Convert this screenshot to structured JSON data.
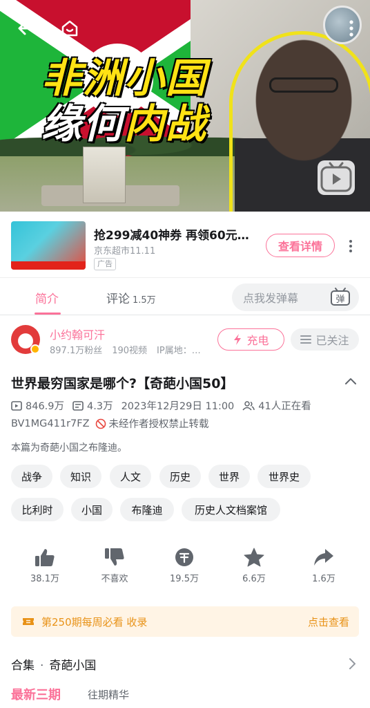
{
  "player": {
    "cover_title_line1": "非洲小国",
    "cover_title_line2_a": "缘何",
    "cover_title_line2_b": "内战",
    "flag_colors": [
      "#c8102e",
      "#1eb53a",
      "#ffffff"
    ],
    "icons": [
      "back-arrow-icon",
      "tv-home-icon",
      "more-vertical-icon",
      "bilibili-tv-icon"
    ]
  },
  "ad": {
    "title": "抢299减40神券 再领60元…",
    "advertiser": "京东超市11.11",
    "tag": "广告",
    "cta": "查看详情"
  },
  "tabs": {
    "intro": "简介",
    "comments": "评论",
    "comments_count": "1.5万",
    "danmu_placeholder": "点我发弹幕",
    "danmu_icon_text": "弹"
  },
  "uploader": {
    "name": "小约翰可汗",
    "fans": "897.1万粉丝",
    "videos": "190视频",
    "ip": "IP属地：…",
    "charge_label": "充电",
    "follow_label": "已关注"
  },
  "video": {
    "title": "世界最穷国家是哪个?【奇葩小国50】",
    "plays": "846.9万",
    "danmaku": "4.3万",
    "date": "2023年12月29日 11:00",
    "watching": "41人正在看",
    "bvid": "BV1MG411r7FZ",
    "copyright": "未经作者授权禁止转载",
    "description": "本篇为奇葩小国之布隆迪。"
  },
  "tags": [
    "战争",
    "知识",
    "人文",
    "历史",
    "世界",
    "世界史",
    "比利时",
    "小国",
    "布隆迪",
    "历史人文档案馆"
  ],
  "actions": {
    "like": "38.1万",
    "dislike": "不喜欢",
    "coin": "19.5万",
    "favorite": "6.6万",
    "share": "1.6万"
  },
  "weekly": {
    "text": "第250期每周必看 收录",
    "link": "点击查看",
    "accent": "#e89217"
  },
  "collection": {
    "label": "合集",
    "name": "奇葩小国",
    "tab_latest": "最新三期",
    "tab_past": "往期精华"
  },
  "theme": {
    "accent": "#fb7299"
  }
}
